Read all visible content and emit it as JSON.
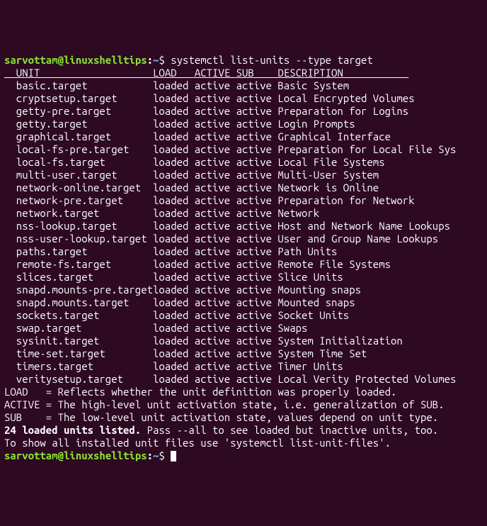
{
  "prompt": {
    "user": "sarvottam",
    "host": "linuxshelltips",
    "path": "~",
    "symbol": "$",
    "command": "systemctl list-units --type target"
  },
  "header": {
    "c0": "  UNIT                   ",
    "c1": "LOAD   ",
    "c2": "ACTIVE ",
    "c3": "SUB    ",
    "c4": "DESCRIPTION           "
  },
  "units": [
    {
      "unit": "basic.target",
      "load": "loaded",
      "active": "active",
      "sub": "active",
      "desc": "Basic System"
    },
    {
      "unit": "cryptsetup.target",
      "load": "loaded",
      "active": "active",
      "sub": "active",
      "desc": "Local Encrypted Volumes"
    },
    {
      "unit": "getty-pre.target",
      "load": "loaded",
      "active": "active",
      "sub": "active",
      "desc": "Preparation for Logins"
    },
    {
      "unit": "getty.target",
      "load": "loaded",
      "active": "active",
      "sub": "active",
      "desc": "Login Prompts"
    },
    {
      "unit": "graphical.target",
      "load": "loaded",
      "active": "active",
      "sub": "active",
      "desc": "Graphical Interface"
    },
    {
      "unit": "local-fs-pre.target",
      "load": "loaded",
      "active": "active",
      "sub": "active",
      "desc": "Preparation for Local File Sys"
    },
    {
      "unit": "local-fs.target",
      "load": "loaded",
      "active": "active",
      "sub": "active",
      "desc": "Local File Systems"
    },
    {
      "unit": "multi-user.target",
      "load": "loaded",
      "active": "active",
      "sub": "active",
      "desc": "Multi-User System"
    },
    {
      "unit": "network-online.target",
      "load": "loaded",
      "active": "active",
      "sub": "active",
      "desc": "Network is Online"
    },
    {
      "unit": "network-pre.target",
      "load": "loaded",
      "active": "active",
      "sub": "active",
      "desc": "Preparation for Network"
    },
    {
      "unit": "network.target",
      "load": "loaded",
      "active": "active",
      "sub": "active",
      "desc": "Network"
    },
    {
      "unit": "nss-lookup.target",
      "load": "loaded",
      "active": "active",
      "sub": "active",
      "desc": "Host and Network Name Lookups"
    },
    {
      "unit": "nss-user-lookup.target",
      "load": "loaded",
      "active": "active",
      "sub": "active",
      "desc": "User and Group Name Lookups"
    },
    {
      "unit": "paths.target",
      "load": "loaded",
      "active": "active",
      "sub": "active",
      "desc": "Path Units"
    },
    {
      "unit": "remote-fs.target",
      "load": "loaded",
      "active": "active",
      "sub": "active",
      "desc": "Remote File Systems"
    },
    {
      "unit": "slices.target",
      "load": "loaded",
      "active": "active",
      "sub": "active",
      "desc": "Slice Units"
    },
    {
      "unit": "snapd.mounts-pre.target",
      "load": "loaded",
      "active": "active",
      "sub": "active",
      "desc": "Mounting snaps"
    },
    {
      "unit": "snapd.mounts.target",
      "load": "loaded",
      "active": "active",
      "sub": "active",
      "desc": "Mounted snaps"
    },
    {
      "unit": "sockets.target",
      "load": "loaded",
      "active": "active",
      "sub": "active",
      "desc": "Socket Units"
    },
    {
      "unit": "swap.target",
      "load": "loaded",
      "active": "active",
      "sub": "active",
      "desc": "Swaps"
    },
    {
      "unit": "sysinit.target",
      "load": "loaded",
      "active": "active",
      "sub": "active",
      "desc": "System Initialization"
    },
    {
      "unit": "time-set.target",
      "load": "loaded",
      "active": "active",
      "sub": "active",
      "desc": "System Time Set"
    },
    {
      "unit": "timers.target",
      "load": "loaded",
      "active": "active",
      "sub": "active",
      "desc": "Timer Units"
    },
    {
      "unit": "veritysetup.target",
      "load": "loaded",
      "active": "active",
      "sub": "active",
      "desc": "Local Verity Protected Volumes"
    }
  ],
  "legend": {
    "load": "LOAD   = Reflects whether the unit definition was properly loaded.",
    "active": "ACTIVE = The high-level unit activation state, i.e. generalization of SUB.",
    "sub": "SUB    = The low-level unit activation state, values depend on unit type."
  },
  "summary": {
    "bold": "24 loaded units listed.",
    "rest": " Pass --all to see loaded but inactive units, too.",
    "line2": "To show all installed unit files use 'systemctl list-unit-files'."
  },
  "col_widths": {
    "unit": 25,
    "load": 7,
    "active": 7,
    "sub": 7
  }
}
